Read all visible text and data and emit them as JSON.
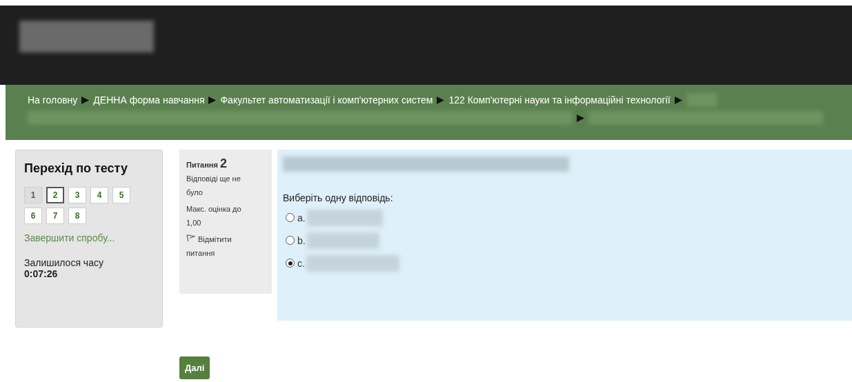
{
  "header": {
    "logo": {
      "kind": "blurred"
    }
  },
  "breadcrumbs": [
    {
      "kind": "link",
      "label": "На головну"
    },
    {
      "kind": "link",
      "label": "ДЕННА форма навчання"
    },
    {
      "kind": "link",
      "label": "Факультет автоматизації і комп'ютерних систем"
    },
    {
      "kind": "link",
      "label": "122 Комп'ютерні науки та інформаційні технології"
    },
    {
      "kind": "blurred"
    },
    {
      "kind": "blurred"
    },
    {
      "kind": "blurred"
    }
  ],
  "quiz_nav": {
    "title": "Перехід по тесту",
    "buttons": [
      {
        "label": "1",
        "answered": true,
        "selected": false
      },
      {
        "label": "2",
        "answered": false,
        "selected": true
      },
      {
        "label": "3",
        "answered": false,
        "selected": false
      },
      {
        "label": "4",
        "answered": false,
        "selected": false
      },
      {
        "label": "5",
        "answered": false,
        "selected": false
      },
      {
        "label": "6",
        "answered": false,
        "selected": false
      },
      {
        "label": "7",
        "answered": false,
        "selected": false
      },
      {
        "label": "8",
        "answered": false,
        "selected": false
      }
    ],
    "finish_link": "Завершити спробу...",
    "time_label": "Залишилося часу",
    "time_value": "0:07:26"
  },
  "question_info": {
    "label": "Питання",
    "number": "2",
    "status": "Відповіді ще не було",
    "grade": "Макс. оцінка до 1,00",
    "flag": "Відмітити питання"
  },
  "question": {
    "text": {
      "kind": "blurred"
    },
    "prompt": "Виберіть одну відповідь:",
    "options": [
      {
        "letter": "a.",
        "selected": false
      },
      {
        "letter": "b.",
        "selected": false
      },
      {
        "letter": "c.",
        "selected": true
      }
    ]
  },
  "next_button": "Далі"
}
